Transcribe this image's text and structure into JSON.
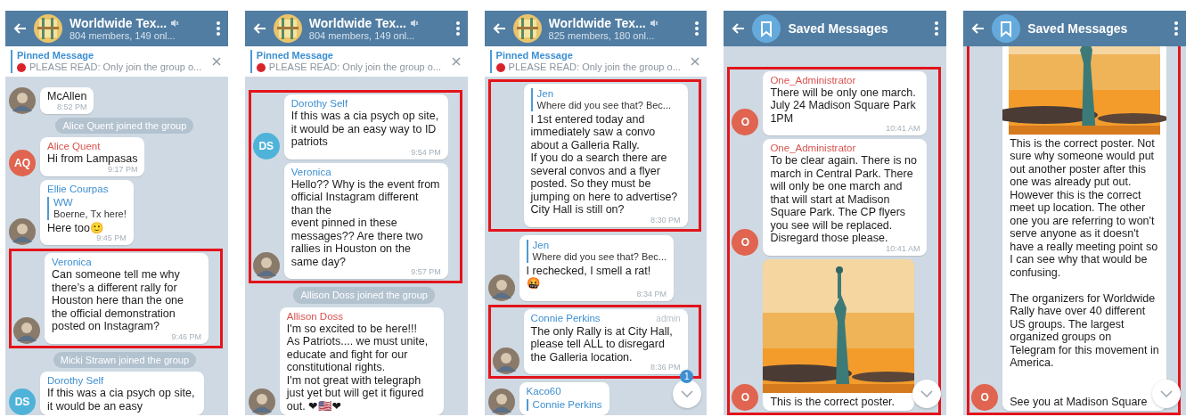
{
  "panels": [
    {
      "header": {
        "kind": "group",
        "title": "Worldwide Tex...",
        "muted": true,
        "subtitle": "804 members, 149 onl..."
      },
      "pinned": {
        "label": "Pinned Message",
        "text": "PLEASE READ:  Only join the group o..."
      },
      "items": [
        {
          "kind": "message",
          "text": "McAllen",
          "time": "8:52 PM"
        },
        {
          "kind": "service",
          "text": "Alice Quent joined the group"
        },
        {
          "kind": "message",
          "avatar": {
            "kind": "initials",
            "text": "AQ",
            "color": "#e0644f"
          },
          "sender": "Alice Quent",
          "color": "#d9534f",
          "text": "Hi from Lampasas",
          "time": "9:17 PM"
        },
        {
          "kind": "message",
          "sender": "Ellie Courpas",
          "color": "#3d8fd1",
          "reply": {
            "author": "WW",
            "text": "Boerne, Tx here!"
          },
          "text": "Here too🙂",
          "time": "9:45 PM"
        },
        {
          "kind": "highlight",
          "items": [
            {
              "kind": "message",
              "sender": "Veronica",
              "color": "#3d8fd1",
              "text": "Can someone tell me why there’s a different rally for Houston here than the one the official demonstration posted on Instagram?",
              "time": "9:46 PM"
            }
          ]
        },
        {
          "kind": "service",
          "text": "Micki Strawn joined the group"
        },
        {
          "kind": "message",
          "avatar": {
            "kind": "initials",
            "text": "DS",
            "color": "#4fb3d9"
          },
          "sender": "Dorothy Self",
          "color": "#3d8fd1",
          "text": "If this was a cia psych op site, it would be an easy"
        }
      ]
    },
    {
      "header": {
        "kind": "group",
        "title": "Worldwide Tex...",
        "muted": true,
        "subtitle": "804 members, 149 onl..."
      },
      "pinned": {
        "label": "Pinned Message",
        "text": "PLEASE READ:  Only join the group o..."
      },
      "items": [
        {
          "kind": "highlight",
          "items": [
            {
              "kind": "message",
              "avatar": {
                "kind": "initials",
                "text": "DS",
                "color": "#4fb3d9"
              },
              "sender": "Dorothy Self",
              "color": "#3d8fd1",
              "text": "If this was a cia psych op site, it would be an easy way to ID patriots",
              "time": "9:54 PM"
            },
            {
              "kind": "message",
              "sender": "Veronica",
              "color": "#3d8fd1",
              "text": "Hello?? Why is the event from official Instagram different than the\nevent pinned in these messages?? Are there two rallies in Houston on the same day?",
              "time": "9:57 PM"
            }
          ]
        },
        {
          "kind": "service",
          "text": "Allison Doss joined the group"
        },
        {
          "kind": "message",
          "sender": "Allison Doss",
          "color": "#d9534f",
          "text": "I'm so excited to be here!!!\nAs Patriots.... we must unite, educate  and fight for our constitutional rights.\nI'm not great with telegraph just yet but will get it figured out. ❤🇺🇸❤"
        }
      ]
    },
    {
      "header": {
        "kind": "group",
        "title": "Worldwide Tex...",
        "muted": true,
        "subtitle": "825 members, 180 onl..."
      },
      "pinned": {
        "label": "Pinned Message",
        "text": "PLEASE READ:  Only join the group o..."
      },
      "scroll_button": {
        "visible": true,
        "badge": "1"
      },
      "items": [
        {
          "kind": "highlight",
          "items": [
            {
              "kind": "message",
              "reply": {
                "author": "Jen",
                "text": "Where did you see that? Bec..."
              },
              "text": "I 1st entered today and immediately saw a convo about a Galleria Rally.\nIf you do a search there are several convos and a flyer posted. So they must be jumping on here to advertise? City Hall is still on?",
              "time": "8:30 PM"
            }
          ]
        },
        {
          "kind": "message",
          "reply": {
            "author": "Jen",
            "text": "Where did you see that? Bec..."
          },
          "text": "I rechecked,  I smell a rat!\n🤬",
          "time": "8:34 PM"
        },
        {
          "kind": "highlight",
          "items": [
            {
              "kind": "message",
              "sender": "Connie Perkins",
              "color": "#3d8fd1",
              "role": "admin",
              "text": "The only Rally is at City Hall, please tell ALL to disregard the Galleria location.",
              "time": "8:36 PM"
            }
          ]
        },
        {
          "kind": "message",
          "sender": "Kaco60",
          "color": "#3d8fd1",
          "reply": {
            "author": "Connie Perkins"
          }
        }
      ]
    },
    {
      "header": {
        "kind": "saved",
        "title": "Saved Messages",
        "muted": false
      },
      "scroll_button": {
        "visible": true
      },
      "items": [
        {
          "kind": "highlight",
          "items": [
            {
              "kind": "message",
              "avatar": {
                "kind": "initials",
                "text": "O",
                "color": "#e0644f"
              },
              "sender": "One_Administrator",
              "color": "#d9534f",
              "text": "There will be only one march. July 24 Madison Square Park 1PM",
              "time": "10:41 AM"
            },
            {
              "kind": "message",
              "avatar": {
                "kind": "initials",
                "text": "O",
                "color": "#e0644f"
              },
              "sender": "One_Administrator",
              "color": "#d9534f",
              "text": "To be clear again. There is no march in Central Park. There will only be one march and that will start at Madison Square Park. The CP flyers you see will be replaced. Disregard those please.",
              "time": "10:41 AM"
            },
            {
              "kind": "message",
              "avatar": {
                "kind": "initials",
                "text": "O",
                "color": "#e0644f"
              },
              "text": "This is the correct poster."
            }
          ]
        }
      ]
    },
    {
      "header": {
        "kind": "saved",
        "title": "Saved Messages",
        "muted": false
      },
      "scroll_button": {
        "visible": true
      },
      "items": [
        {
          "kind": "highlight",
          "items": [
            {
              "kind": "message",
              "avatar": {
                "kind": "initials",
                "text": "O",
                "color": "#e0644f"
              },
              "text": "This is the correct poster. Not sure why someone would put out another poster after this one was already put out. However this is the correct meet up location. The other one you are referring  to won't serve anyone as it doesn't have a really meeting point so I can see why that would be confusing.\n\nThe organizers for Worldwide Rally have over 40 different US groups. The largest organized groups on Telegram for this movement in America.\n\n\nSee you at Madison Square"
            }
          ]
        }
      ]
    }
  ]
}
